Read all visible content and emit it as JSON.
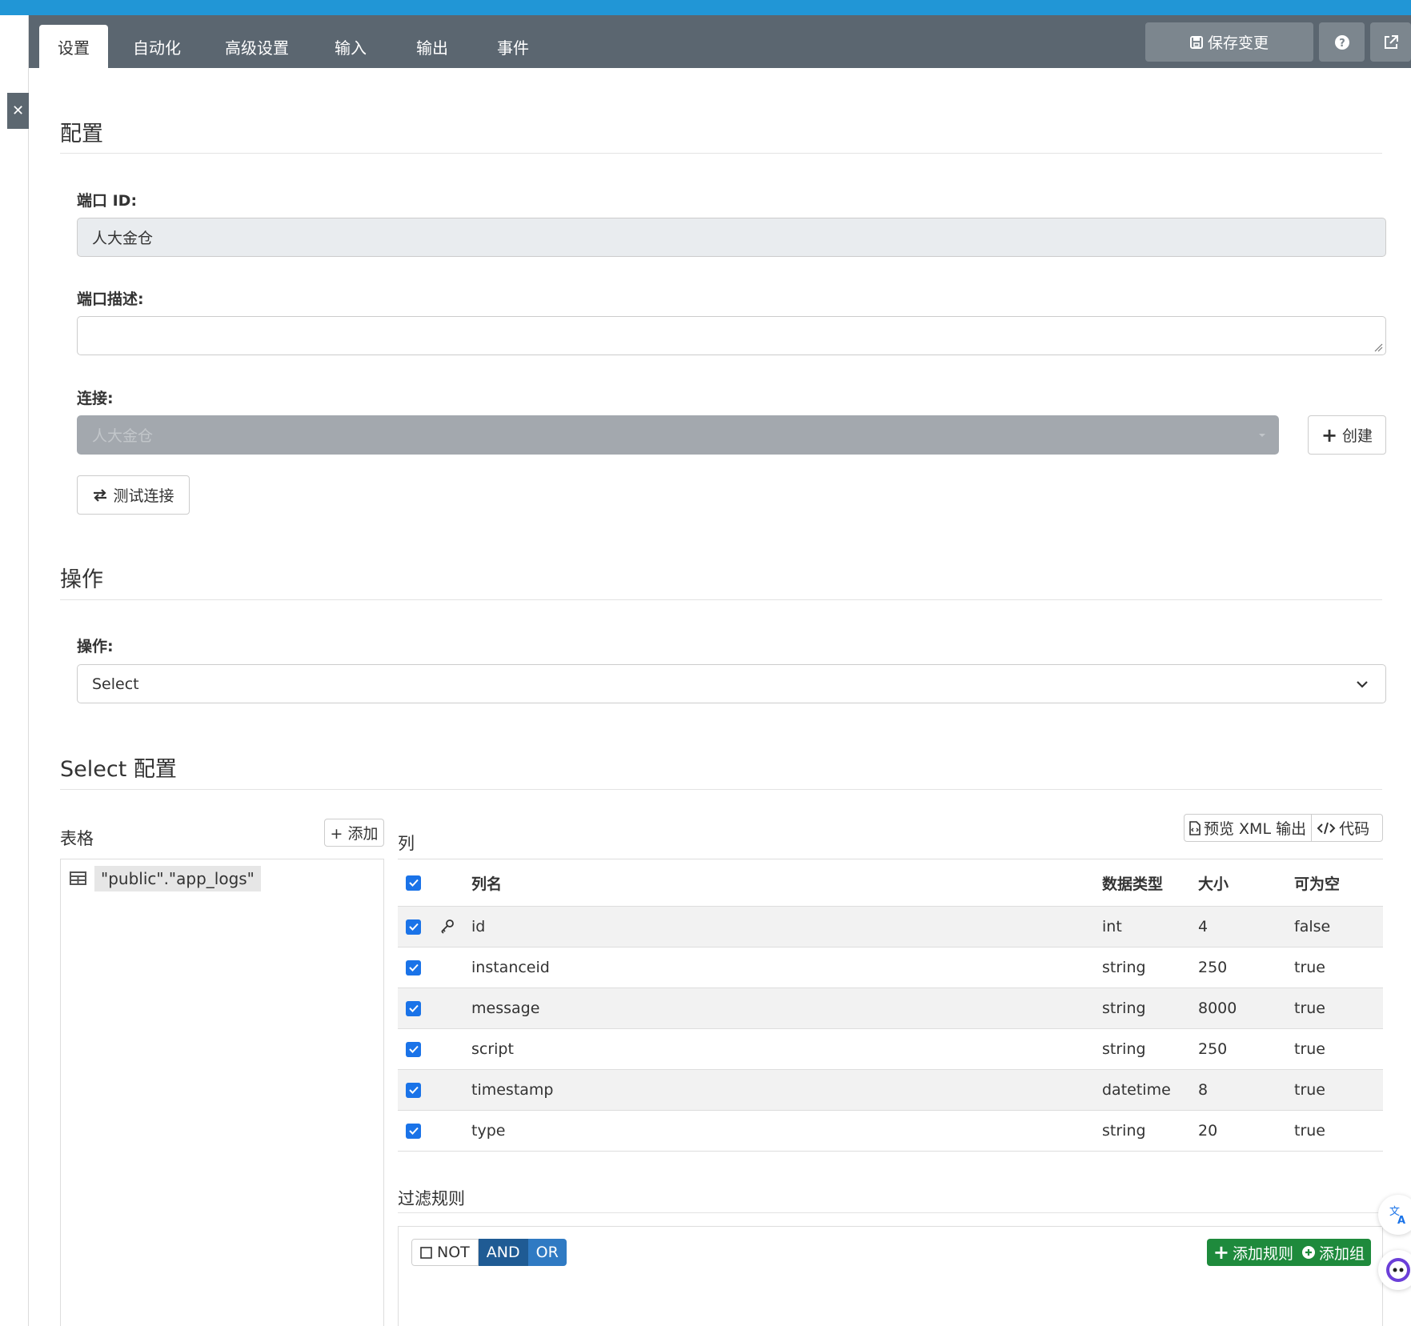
{
  "nav": {
    "tabs": [
      "设置",
      "自动化",
      "高级设置",
      "输入",
      "输出",
      "事件"
    ],
    "save_label": "保存变更"
  },
  "config": {
    "title": "配置",
    "port_id_label": "端口 ID:",
    "port_id_value": "人大金仓",
    "desc_label": "端口描述:",
    "desc_value": "",
    "conn_label": "连接:",
    "conn_value": "人大金仓",
    "create_label": "创建",
    "test_label": "测试连接"
  },
  "operation": {
    "title": "操作",
    "label": "操作:",
    "value": "Select"
  },
  "select_config": {
    "title": "Select 配置",
    "tables_label": "表格",
    "add_label": "+ 添加",
    "table_name": "\"public\".\"app_logs\"",
    "columns_label": "列",
    "preview_label": "预览 XML 输出",
    "code_label": "代码",
    "headers": {
      "name": "列名",
      "type": "数据类型",
      "size": "大小",
      "nullable": "可为空"
    },
    "rows": [
      {
        "name": "id",
        "type": "int",
        "size": "4",
        "nullable": "false",
        "key": true
      },
      {
        "name": "instanceid",
        "type": "string",
        "size": "250",
        "nullable": "true"
      },
      {
        "name": "message",
        "type": "string",
        "size": "8000",
        "nullable": "true"
      },
      {
        "name": "script",
        "type": "string",
        "size": "250",
        "nullable": "true"
      },
      {
        "name": "timestamp",
        "type": "datetime",
        "size": "8",
        "nullable": "true"
      },
      {
        "name": "type",
        "type": "string",
        "size": "20",
        "nullable": "true"
      }
    ],
    "filter_label": "过滤规则",
    "not_label": "NOT",
    "and_label": "AND",
    "or_label": "OR",
    "add_rule_label": "添加规则",
    "add_group_label": "添加组"
  },
  "colors": {
    "nav": "#5b6670",
    "primary": "#1a73e8",
    "green": "#1e8a3c",
    "and": "#1f5b94",
    "or": "#2f7ac3",
    "topbar": "#2196d6"
  }
}
